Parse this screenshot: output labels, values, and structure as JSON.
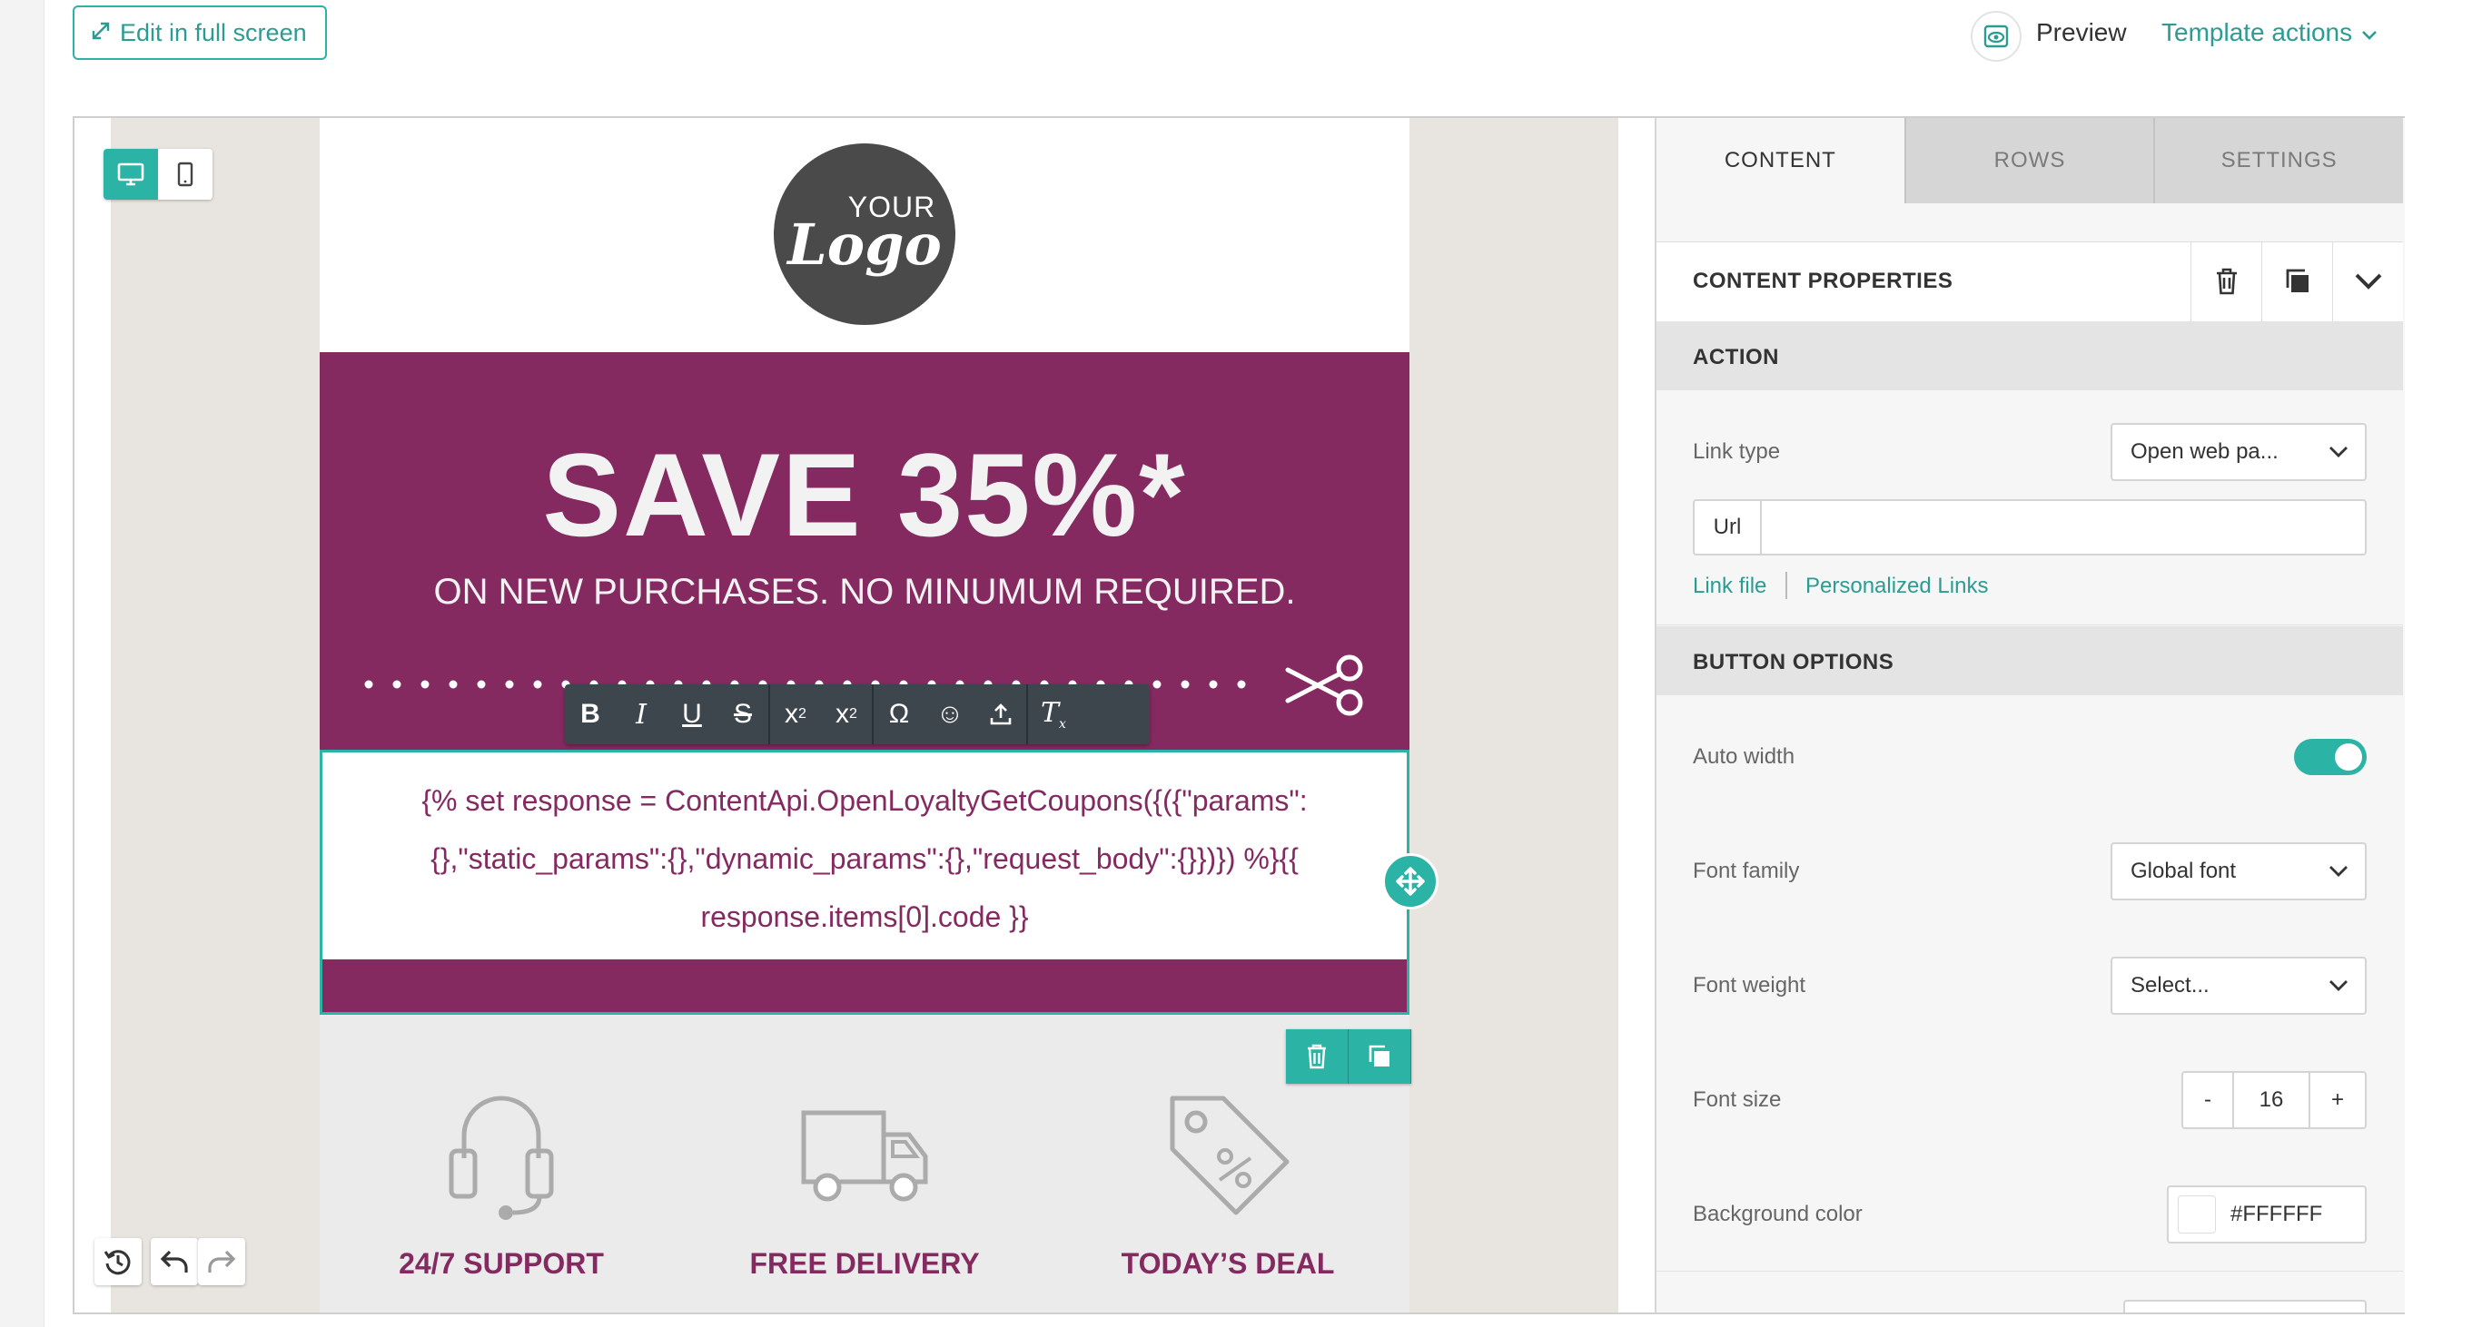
{
  "topbar": {
    "fullscreen_label": "Edit in full screen",
    "preview_label": "Preview",
    "template_actions_label": "Template actions"
  },
  "email": {
    "logo_top": "YOUR",
    "logo_main": "Logo",
    "headline": "SAVE 35%*",
    "subheadline": "ON NEW PURCHASES. NO MINUMUM REQUIRED.",
    "code_line1": "{% set response = ContentApi.OpenLoyaltyGetCoupons({({\"params\":",
    "code_line2": "{},\"static_params\":{},\"dynamic_params\":{},\"request_body\":{}})})  %}{{",
    "code_line3": "response.items[0].code }}",
    "features": [
      {
        "label": "24/7 SUPPORT",
        "icon": "headset-icon"
      },
      {
        "label": "FREE DELIVERY",
        "icon": "truck-icon"
      },
      {
        "label": "TODAY’S DEAL",
        "icon": "price-tag-icon"
      }
    ],
    "colors": {
      "promo": "#852a60",
      "accent": "#2bb3a6"
    }
  },
  "toolbar": {
    "groups": [
      [
        "bold-icon",
        "italic-icon",
        "underline-icon",
        "strikethrough-icon"
      ],
      [
        "superscript-icon",
        "subscript-icon"
      ],
      [
        "special-char-icon",
        "emoji-icon",
        "upload-icon"
      ],
      [
        "clear-format-icon"
      ]
    ]
  },
  "panel": {
    "tabs": [
      "CONTENT",
      "ROWS",
      "SETTINGS"
    ],
    "props_title": "CONTENT PROPERTIES",
    "action_section": "ACTION",
    "link_type_label": "Link type",
    "link_type_value": "Open web pa...",
    "url_label": "Url",
    "url_value": "",
    "link_file": "Link file",
    "personalized_links": "Personalized Links",
    "button_options_section": "BUTTON OPTIONS",
    "auto_width_label": "Auto width",
    "auto_width_on": true,
    "font_family_label": "Font family",
    "font_family_value": "Global font",
    "font_weight_label": "Font weight",
    "font_weight_value": "Select...",
    "font_size_label": "Font size",
    "font_size_value": "16",
    "minus": "-",
    "plus": "+",
    "bg_color_label": "Background color",
    "bg_color_value": "#FFFFFF"
  }
}
